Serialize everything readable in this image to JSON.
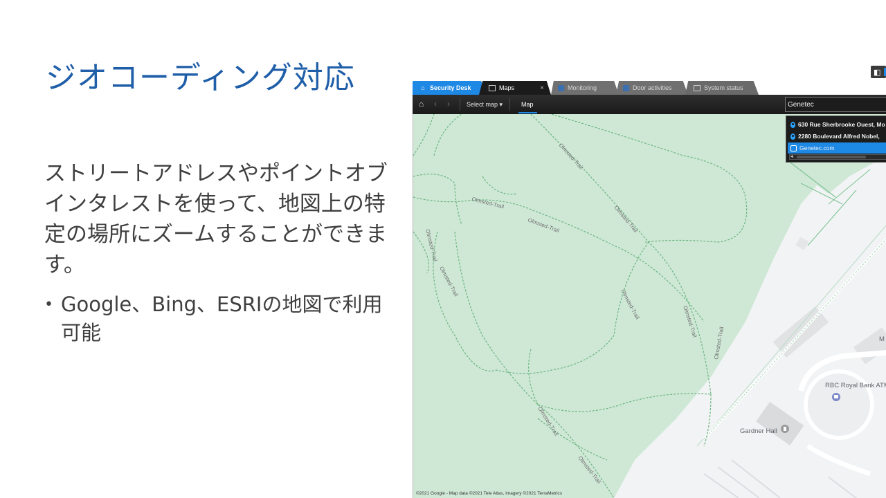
{
  "slide": {
    "title": "ジオコーディング対応",
    "body": "ストリートアドレスやポイントオブインタレストを使って、地図上の特定の場所にズームすることができます。",
    "bullet": "Google、Bing、ESRIの地図で利用可能"
  },
  "app": {
    "tabs": {
      "security_desk": "Security Desk",
      "maps": "Maps",
      "monitoring": "Monitoring",
      "door_activities": "Door activities",
      "system_status": "System status",
      "close_glyph": "×"
    },
    "toolbar": {
      "select_map": "Select map ▾",
      "map": "Map",
      "search_value": "Genetec"
    },
    "search_results": [
      "630 Rue Sherbrooke Ouest, Mo",
      "2280 Boulevard Alfred Nobel,",
      "Genetec.com"
    ],
    "map": {
      "trail_name": "Olmsted-Trail",
      "poi": {
        "rbc": "RBC Royal Bank ATM",
        "gardner": "Gardner Hall",
        "partial": "M"
      },
      "attribution": "©2021 Google - Map data ©2021 Tele Atlas, Imagery ©2021 TerraMetrics"
    },
    "colors": {
      "accent": "#1e88e5",
      "park": "#cfe8d6",
      "trail": "#6ab57f"
    }
  }
}
